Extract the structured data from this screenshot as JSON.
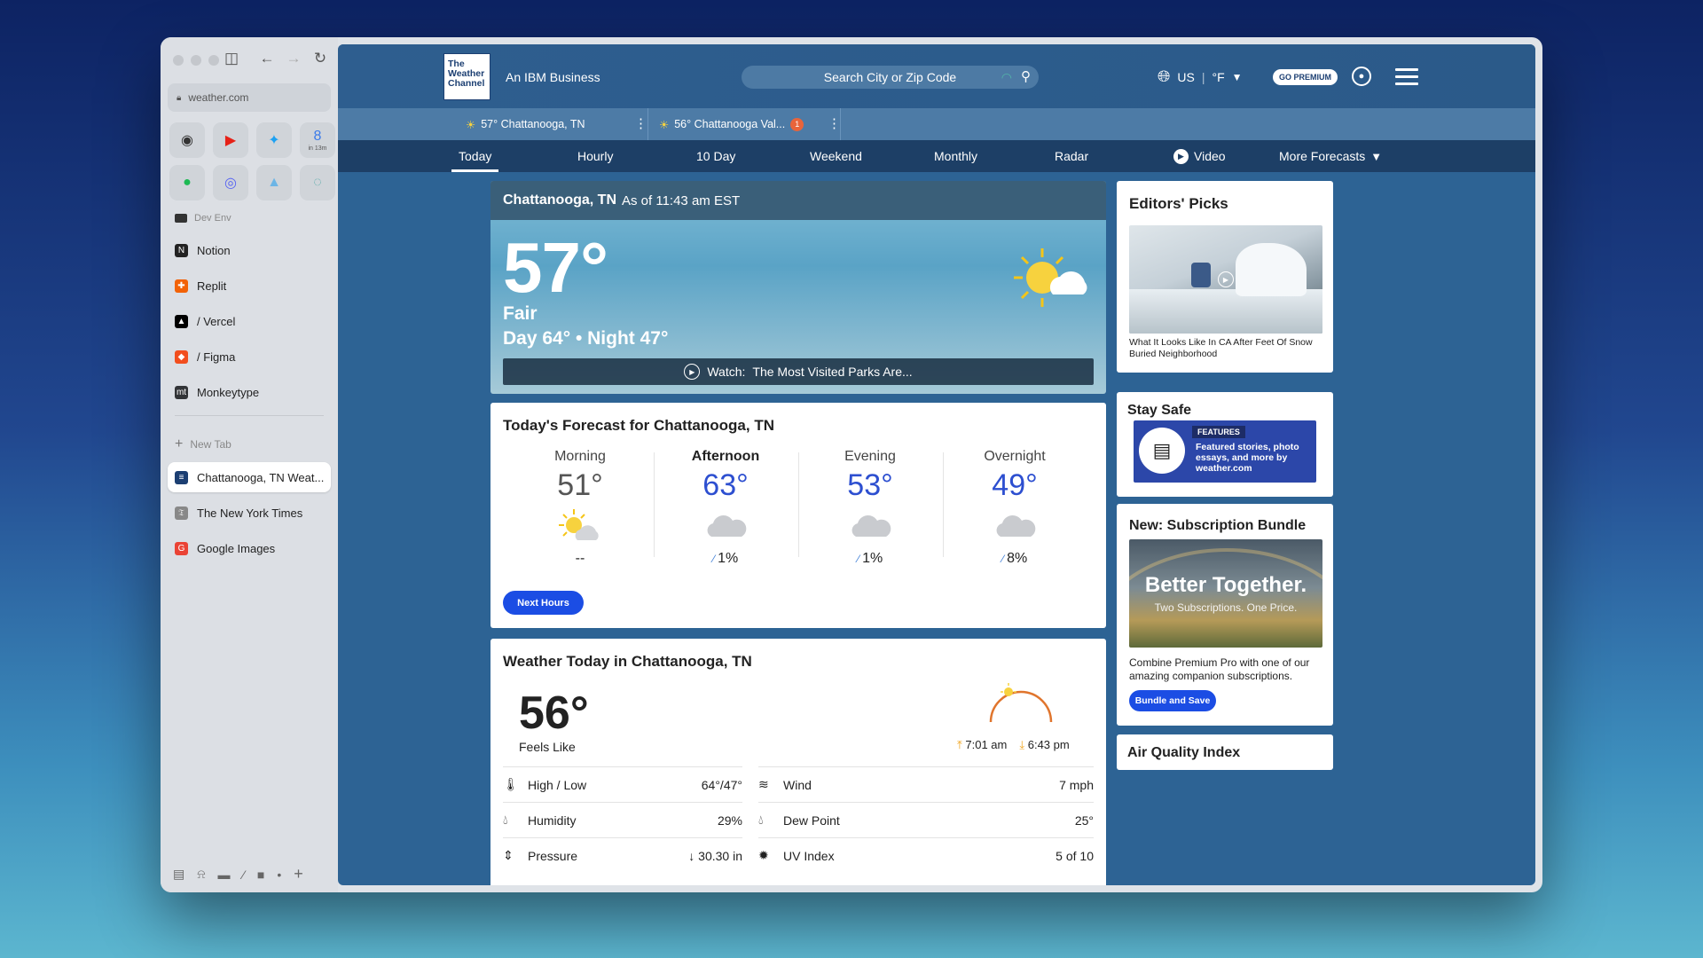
{
  "sidebar": {
    "url": "weather.com",
    "pins": [
      {
        "icon": "github-icon",
        "glyph": "◉",
        "color": "#333"
      },
      {
        "icon": "youtube-icon",
        "glyph": "▶",
        "color": "#e62117"
      },
      {
        "icon": "twitter-icon",
        "glyph": "✦",
        "color": "#1da1f2"
      },
      {
        "icon": "calendar-icon",
        "glyph": "8",
        "color": "#3b7bea",
        "note": "in 13m"
      },
      {
        "icon": "spotify-icon",
        "glyph": "●",
        "color": "#1db954"
      },
      {
        "icon": "discord-icon",
        "glyph": "◎",
        "color": "#5865f2"
      },
      {
        "icon": "arc-icon",
        "glyph": "▲",
        "color": "#6cb5e6"
      },
      {
        "icon": "globe-icon",
        "glyph": "◌",
        "color": "#5aa"
      }
    ],
    "folder_label": "Dev Env",
    "items": [
      {
        "label": "Notion",
        "icon": "notion-icon",
        "glyph": "N",
        "color": "#222"
      },
      {
        "label": "Replit",
        "icon": "replit-icon",
        "glyph": "✚",
        "color": "#f26207"
      },
      {
        "label": "/ Vercel",
        "icon": "vercel-icon",
        "glyph": "▲",
        "color": "#000"
      },
      {
        "label": "/ Figma",
        "icon": "figma-icon",
        "glyph": "◆",
        "color": "#f24e1e"
      },
      {
        "label": "Monkeytype",
        "icon": "monkeytype-icon",
        "glyph": "mt",
        "color": "#323437"
      }
    ],
    "new_tab": "New Tab",
    "tabs": [
      {
        "label": "Chattanooga, TN Weat...",
        "icon": "weather-channel-icon",
        "glyph": "≡",
        "color": "#1c3f72",
        "active": true
      },
      {
        "label": "The New York Times",
        "icon": "nyt-icon",
        "glyph": "𝔗",
        "color": "#888"
      },
      {
        "label": "Google Images",
        "icon": "google-icon",
        "glyph": "G",
        "color": "#ea4335"
      }
    ]
  },
  "header": {
    "logo": "The Weather Channel",
    "logo_lines": [
      "The",
      "Weather",
      "Channel"
    ],
    "tagline": "An IBM Business",
    "search_placeholder": "Search City or Zip Code",
    "region": "US",
    "unit": "°F",
    "premium": "GO PREMIUM"
  },
  "location_tabs": [
    {
      "label": "57° Chattanooga, TN"
    },
    {
      "label": "56° Chattanooga Val...",
      "badge": "1"
    }
  ],
  "nav": [
    "Today",
    "Hourly",
    "10 Day",
    "Weekend",
    "Monthly",
    "Radar",
    "Video",
    "More Forecasts"
  ],
  "current": {
    "location": "Chattanooga, TN",
    "as_of": "As of 11:43 am EST",
    "temp": "57°",
    "condition": "Fair",
    "day_night": "Day 64° • Night 47°",
    "watch_label": "Watch:",
    "watch_title": "The Most Visited Parks Are..."
  },
  "forecast": {
    "title": "Today's Forecast for Chattanooga, TN",
    "periods": [
      {
        "name": "Morning",
        "temp": "51°",
        "precip": "--",
        "icon": "partly-sunny-icon"
      },
      {
        "name": "Afternoon",
        "temp": "63°",
        "precip": "1%",
        "icon": "cloud-icon"
      },
      {
        "name": "Evening",
        "temp": "53°",
        "precip": "1%",
        "icon": "cloud-icon"
      },
      {
        "name": "Overnight",
        "temp": "49°",
        "precip": "8%",
        "icon": "cloud-icon"
      }
    ],
    "button": "Next Hours"
  },
  "details": {
    "title": "Weather Today in Chattanooga, TN",
    "feels_like_temp": "56°",
    "feels_like_label": "Feels Like",
    "sunrise": "7:01 am",
    "sunset": "6:43 pm",
    "left_rows": [
      {
        "label": "High / Low",
        "value": "64°/47°",
        "icon": "thermometer-icon"
      },
      {
        "label": "Humidity",
        "value": "29%",
        "icon": "humidity-icon"
      },
      {
        "label": "Pressure",
        "value": "↓ 30.30 in",
        "icon": "pressure-icon"
      }
    ],
    "right_rows": [
      {
        "label": "Wind",
        "value": "7 mph",
        "icon": "wind-icon"
      },
      {
        "label": "Dew Point",
        "value": "25°",
        "icon": "dew-point-icon"
      },
      {
        "label": "UV Index",
        "value": "5 of 10",
        "icon": "uv-icon"
      }
    ]
  },
  "editors": {
    "title": "Editors' Picks",
    "caption": "What It Looks Like In CA After Feet Of Snow Buried Neighborhood"
  },
  "stay_safe": {
    "title": "Stay Safe",
    "tag": "FEATURES",
    "text": "Featured stories, photo essays, and more by weather.com"
  },
  "bundle": {
    "title": "New: Subscription Bundle",
    "headline": "Better Together.",
    "subline": "Two Subscriptions. One Price.",
    "body": "Combine Premium Pro with one of our amazing companion subscriptions.",
    "button": "Bundle and Save"
  },
  "aqi": {
    "title": "Air Quality Index"
  },
  "colors": {
    "accent": "#1b4de4",
    "navy": "#1d3f66",
    "header": "#2e5e8f"
  }
}
